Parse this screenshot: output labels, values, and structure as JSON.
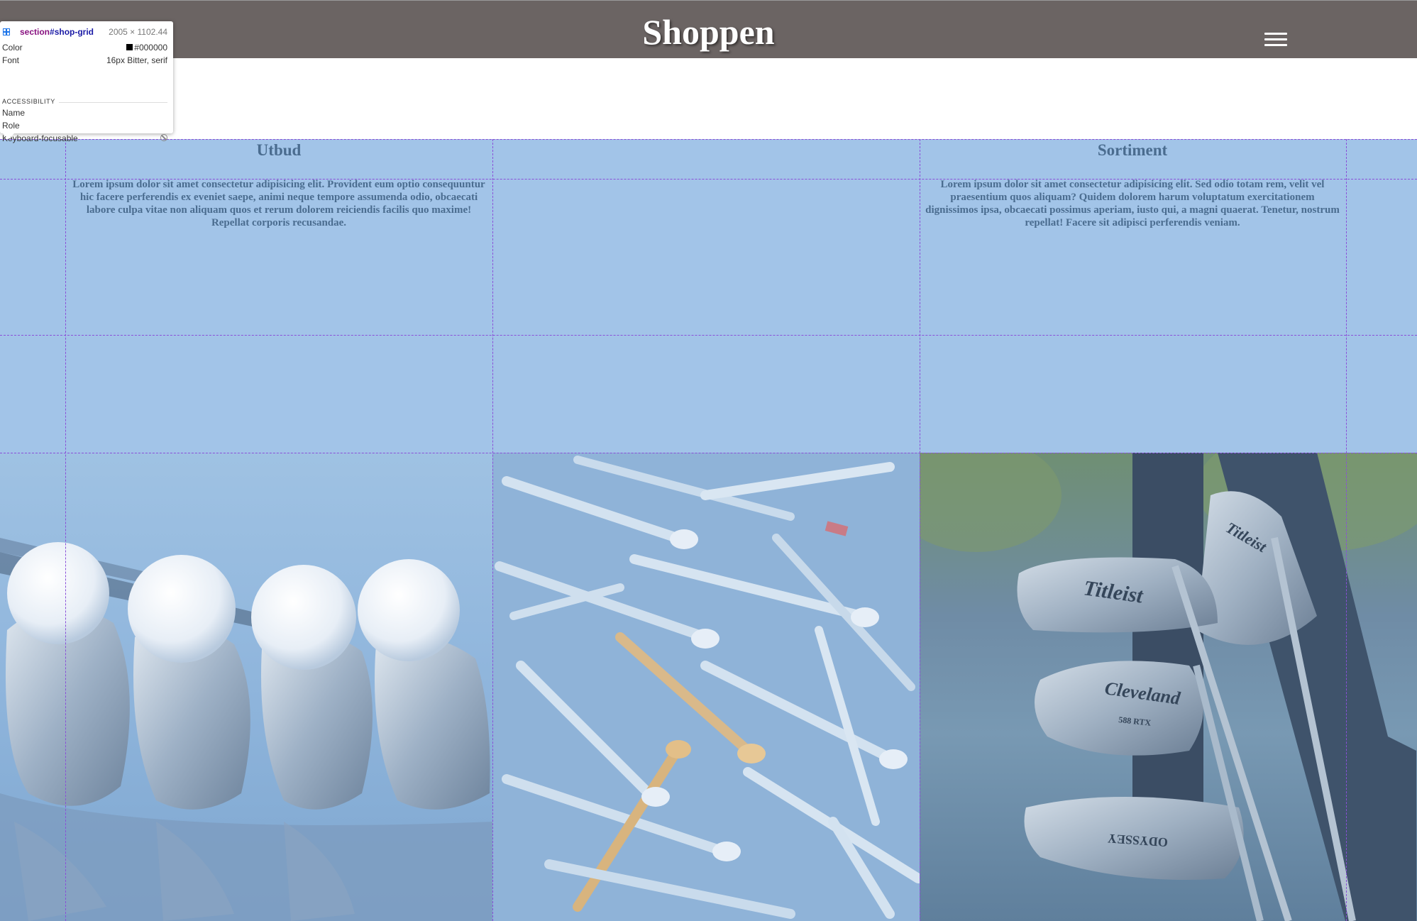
{
  "header": {
    "title": "Shoppen",
    "menu_icon": "hamburger-menu-icon"
  },
  "shop_grid": {
    "columns": [
      {
        "title": "Utbud",
        "text": "Lorem ipsum dolor sit amet consectetur adipisicing elit. Provident eum optio consequuntur hic facere perferendis ex eveniet saepe, animi neque tempore assumenda odio, obcaecati labore culpa vitae non aliquam quos et rerum dolorem reiciendis facilis quo maxime! Repellat corporis recusandae."
      },
      {
        "title": "Sortiment",
        "text": "Lorem ipsum dolor sit amet consectetur adipisicing elit. Sed odio totam rem, velit vel praesentium quos aliquam? Quidem dolorem harum voluptatum exercitationem dignissimos ipsa, obcaecati possimus aperiam, iusto qui, a magni quaerat. Tenetur, nostrum repellat! Facere sit adipisci perferendis veniam."
      }
    ],
    "images": [
      {
        "subject": "golf balls resting on wedges",
        "brands": []
      },
      {
        "subject": "pile of wooden golf tees",
        "brands": []
      },
      {
        "subject": "golf irons in a bag",
        "brands": [
          "Titleist",
          "Cleveland",
          "588 RTX",
          "ODYSSEY",
          "Titleist"
        ]
      }
    ],
    "overlay_color": "#a2c4e8"
  },
  "devtools_tooltip": {
    "selector_tag": "section",
    "selector_id": "#shop-grid",
    "dimensions": "2005 × 1102.44",
    "rows": [
      {
        "key": "Color",
        "value": "#000000"
      },
      {
        "key": "Font",
        "value": "16px Bitter, serif"
      }
    ],
    "section_title": "ACCESSIBILITY",
    "accessibility": [
      {
        "key": "Name",
        "value": ""
      },
      {
        "key": "Role",
        "value": ""
      },
      {
        "key": "Keyboard-focusable",
        "value": ""
      }
    ],
    "grid_line_color": "#8a4fd8"
  }
}
